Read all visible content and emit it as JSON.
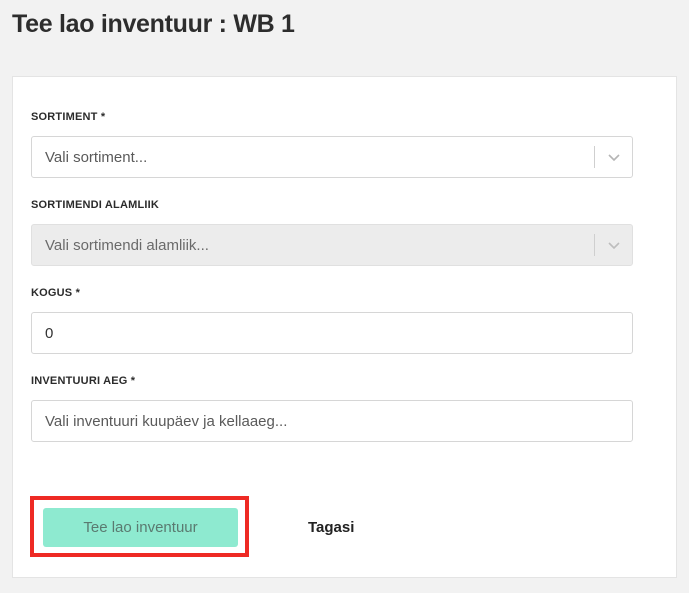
{
  "page": {
    "title": "Tee lao inventuur : WB 1"
  },
  "form": {
    "sortiment": {
      "label": "SORTIMENT *",
      "placeholder": "Vali sortiment..."
    },
    "alamliik": {
      "label": "SORTIMENDI ALAMLIIK",
      "placeholder": "Vali sortimendi alamliik...",
      "disabled": true
    },
    "kogus": {
      "label": "KOGUS *",
      "value": "0"
    },
    "aeg": {
      "label": "INVENTUURI AEG *",
      "placeholder": "Vali inventuuri kuupäev ja kellaaeg..."
    }
  },
  "actions": {
    "submit_label": "Tee lao inventuur",
    "back_label": "Tagasi"
  },
  "colors": {
    "submit_bg": "#8eead0",
    "highlight": "#ee2a24",
    "background": "#f2f2f2"
  },
  "icons": {
    "select_toggle": "chevron-down-icon"
  }
}
